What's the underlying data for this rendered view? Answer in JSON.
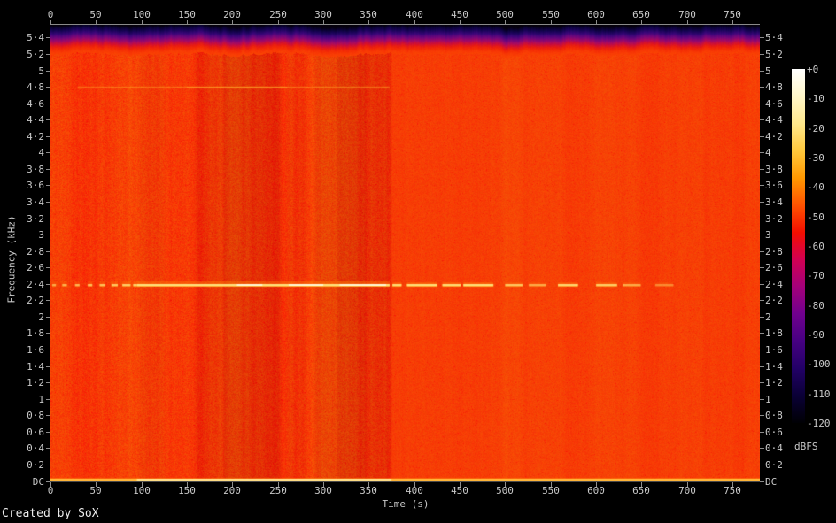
{
  "meta": {
    "credit": "Created by SoX"
  },
  "chart_data": {
    "type": "heatmap",
    "subtype": "audio-spectrogram",
    "title": "",
    "xlabel": "Time (s)",
    "ylabel": "Frequency (kHz)",
    "x_max_s": 780,
    "x_ticks": [
      "0",
      "50",
      "100",
      "150",
      "200",
      "250",
      "300",
      "350",
      "400",
      "450",
      "500",
      "550",
      "600",
      "650",
      "700",
      "750"
    ],
    "y_ticks": [
      "DC",
      "0·2",
      "0·4",
      "0·6",
      "0·8",
      "1",
      "1·2",
      "1·4",
      "1·6",
      "1·8",
      "2",
      "2·2",
      "2·4",
      "2·6",
      "2·8",
      "3",
      "3·2",
      "3·4",
      "3·6",
      "3·8",
      "4",
      "4·2",
      "4·4",
      "4·6",
      "4·8",
      "5",
      "5·2",
      "5·4"
    ],
    "y_tick_step_khz": 0.2,
    "grid": false,
    "colorbar": {
      "unit": "dBFS",
      "ticks": [
        "+0",
        "-10",
        "-20",
        "-30",
        "-40",
        "-50",
        "-60",
        "-70",
        "-80",
        "-90",
        "-100",
        "-110",
        "-120"
      ],
      "palette_top_to_bottom": [
        "#ffffff",
        "#fff6c8",
        "#ffe88c",
        "#ffc83c",
        "#ff9800",
        "#ff5200",
        "#f30e00",
        "#d20052",
        "#a4007a",
        "#70008e",
        "#460082",
        "#220066",
        "#0a0036",
        "#000004"
      ]
    },
    "colors": {
      "background": "#000000",
      "plot_base_orange": "#fa4203",
      "axis_text": "#c8c8c8",
      "tick": "#8c8c8c",
      "top_axis_line": "#8a8a8a",
      "bottom_axis_line": "#4a4a4a",
      "tone_core": "#ffe482",
      "tone_mid": "#ffc23c",
      "tone_glow": "#ff7e06",
      "tone_hot": "#fffad7",
      "dc_line": "#ffd24a",
      "dc_line_bright": "#ffee96"
    },
    "features": {
      "nyquist_rolloff_rows": [
        {
          "row": 0,
          "color": "#05010c"
        },
        {
          "row": 3,
          "color": "#0a0234"
        },
        {
          "row": 6,
          "color": "#180456"
        },
        {
          "row": 10,
          "color": "#3a0678"
        },
        {
          "row": 14,
          "color": "#6e077c"
        },
        {
          "row": 18,
          "color": "#a40a64"
        },
        {
          "row": 21,
          "color": "#cc0e38"
        },
        {
          "row": 24,
          "color": "#e81c12"
        },
        {
          "row": 27,
          "color": "#f42c05"
        },
        {
          "row": 30,
          "color": "#f83a04"
        },
        {
          "row": 33,
          "color": "#fa4203"
        }
      ],
      "dark_time_bands_s": [
        {
          "t0": 100,
          "t1": 122,
          "strength": 0.1
        },
        {
          "t0": 162,
          "t1": 189,
          "strength": 0.2
        },
        {
          "t0": 191,
          "t1": 250,
          "strength": 0.34
        },
        {
          "t0": 262,
          "t1": 278,
          "strength": 0.12
        },
        {
          "t0": 293,
          "t1": 314,
          "strength": 0.22
        },
        {
          "t0": 316,
          "t1": 346,
          "strength": 0.38
        },
        {
          "t0": 348,
          "t1": 371,
          "strength": 0.28
        }
      ],
      "tone_2400": {
        "freq_khz": 2.4,
        "segments_s": [
          [
            2,
            6,
            0.45
          ],
          [
            13,
            18,
            0.5
          ],
          [
            27,
            32,
            0.55
          ],
          [
            41,
            46,
            0.6
          ],
          [
            54,
            60,
            0.6
          ],
          [
            67,
            74,
            0.65
          ],
          [
            79,
            88,
            0.7
          ],
          [
            91,
            95,
            0.75
          ],
          [
            95,
            373,
            0.95
          ]
        ],
        "hot_segments_s": [
          [
            205,
            233,
            1
          ],
          [
            262,
            300,
            1
          ],
          [
            318,
            369,
            1
          ]
        ],
        "post_segments_s": [
          [
            376,
            386,
            0.85
          ],
          [
            392,
            425,
            0.9
          ],
          [
            431,
            451,
            0.85
          ],
          [
            454,
            487,
            0.9
          ],
          [
            500,
            519,
            0.65
          ],
          [
            526,
            545,
            0.45
          ],
          [
            558,
            580,
            0.8
          ],
          [
            600,
            623,
            0.7
          ],
          [
            629,
            649,
            0.45
          ],
          [
            665,
            685,
            0.3
          ]
        ]
      },
      "tone_4800": {
        "freq_khz": 4.8,
        "segments_s": [
          [
            30,
            150,
            0.3
          ],
          [
            150,
            260,
            0.5
          ],
          [
            260,
            373,
            0.32
          ]
        ]
      },
      "dc_line": {
        "base_alpha": 0.85,
        "bright_span_s": [
          95,
          375
        ]
      },
      "texture_smooth_after_s": 374
    }
  }
}
